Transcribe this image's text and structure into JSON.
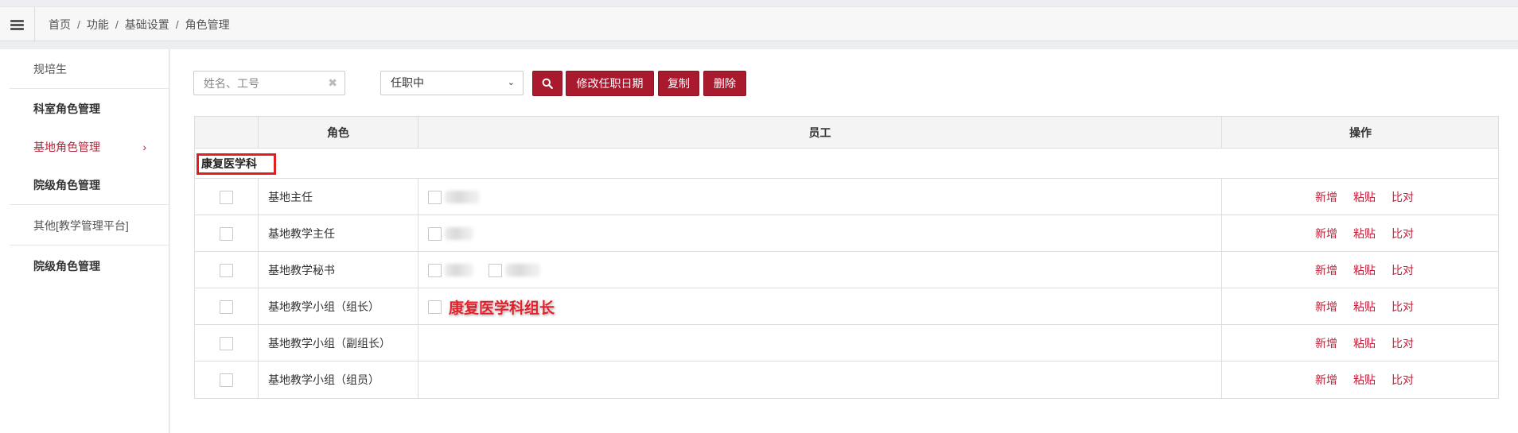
{
  "breadcrumb": [
    "首页",
    "功能",
    "基础设置",
    "角色管理"
  ],
  "sidebar": {
    "items": [
      {
        "label": "规培生"
      },
      {
        "label": "科室角色管理"
      },
      {
        "label": "基地角色管理",
        "active": true
      },
      {
        "label": "院级角色管理"
      },
      {
        "label": "其他[教学管理平台]"
      },
      {
        "label": "院级角色管理"
      }
    ],
    "active_chevron": "›"
  },
  "toolbar": {
    "search_placeholder": "姓名、工号",
    "clear_symbol": "✖",
    "status_value": "任职中",
    "modify_date_label": "修改任职日期",
    "copy_label": "复制",
    "delete_label": "删除"
  },
  "table": {
    "headers": {
      "role": "角色",
      "staff": "员工",
      "ops": "操作"
    },
    "group": "康复医学科",
    "rows": [
      {
        "role": "基地主任",
        "staff_count": 1
      },
      {
        "role": "基地教学主任",
        "staff_count": 1
      },
      {
        "role": "基地教学秘书",
        "staff_count": 2
      },
      {
        "role": "基地教学小组（组长）",
        "staff_count": 1,
        "annotation": "康复医学科组长"
      },
      {
        "role": "基地教学小组（副组长）",
        "staff_count": 0
      },
      {
        "role": "基地教学小组（组员）",
        "staff_count": 0
      }
    ],
    "ops": {
      "add": "新增",
      "paste": "粘贴",
      "compare": "比对"
    }
  },
  "colors": {
    "accent": "#a91a2e",
    "link": "#c0203a",
    "highlight_box": "#e02020"
  }
}
